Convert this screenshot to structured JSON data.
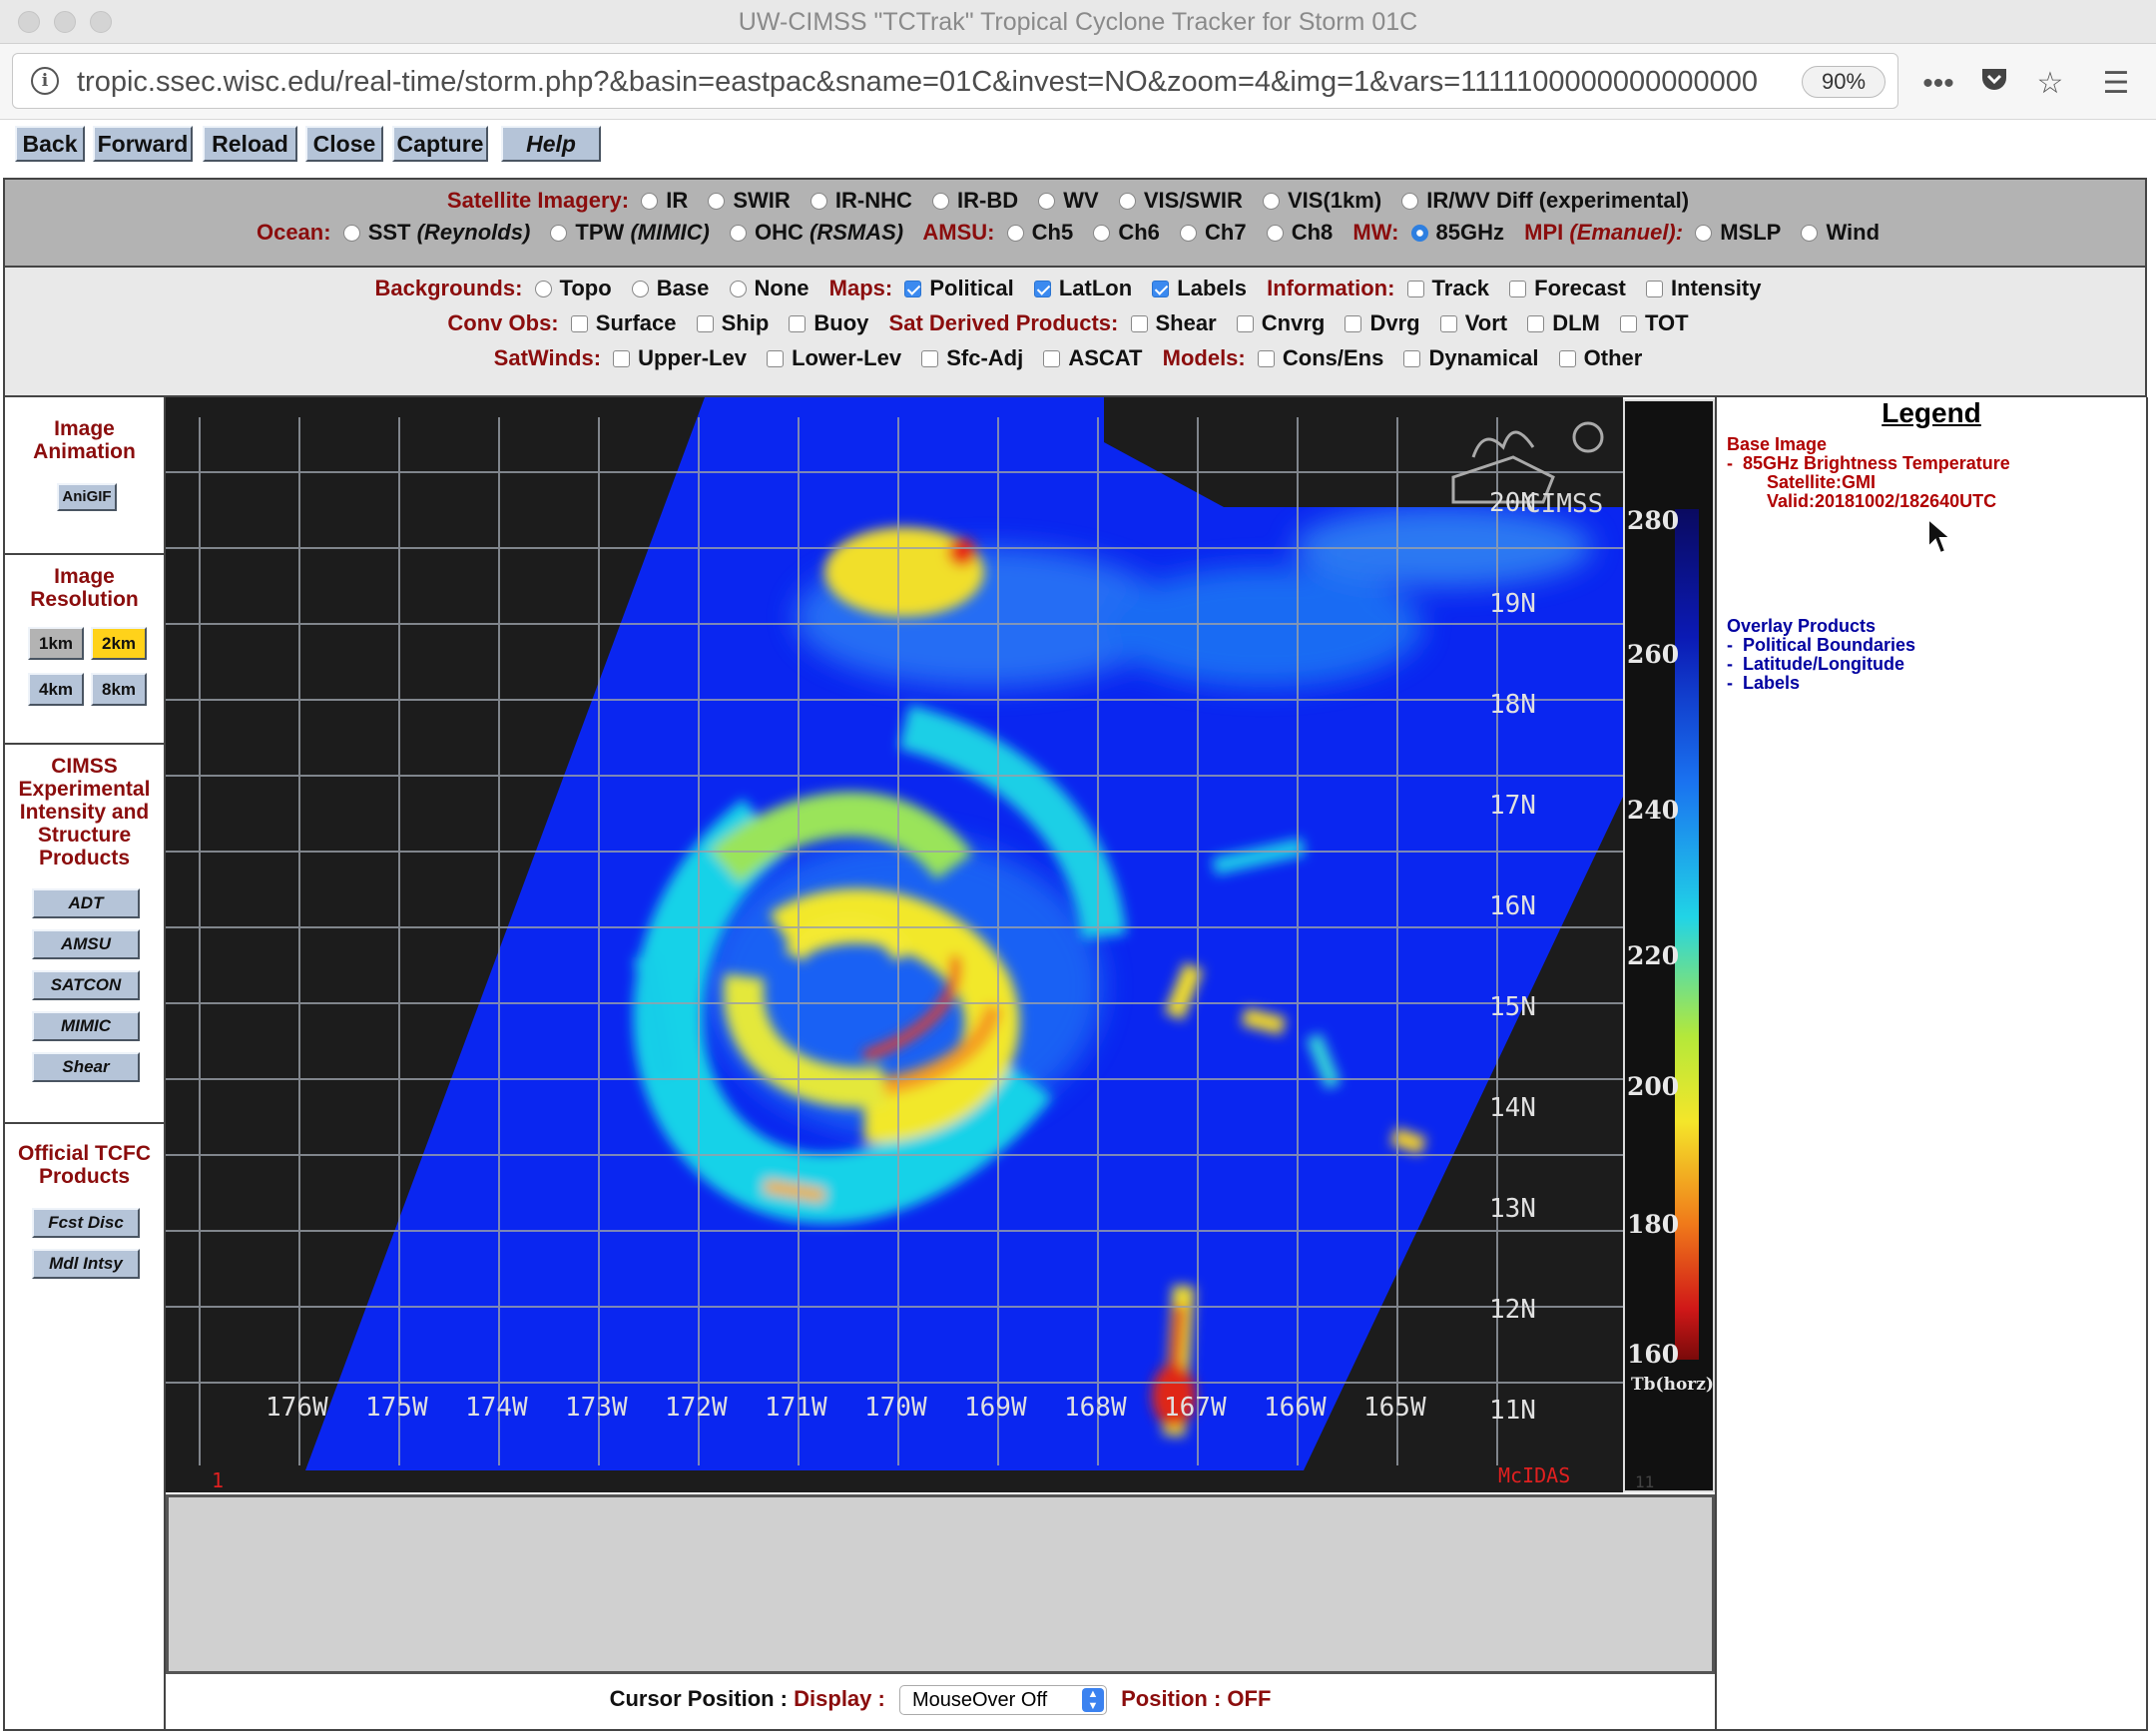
{
  "window": {
    "title": "UW-CIMSS \"TCTrak\" Tropical Cyclone Tracker for Storm 01C"
  },
  "browser": {
    "url": "tropic.ssec.wisc.edu/real-time/storm.php?&basin=eastpac&sname=01C&invest=NO&zoom=4&img=1&vars=1111100000000000000",
    "zoom": "90%",
    "icons": [
      "info-icon",
      "more-icon",
      "pocket-icon",
      "bookmark-star-icon",
      "reader-menu-icon"
    ]
  },
  "nav_buttons": {
    "back": "Back",
    "forward": "Forward",
    "reload": "Reload",
    "close": "Close",
    "capture": "Capture",
    "help": "Help"
  },
  "row1": {
    "label": "Satellite Imagery:",
    "options": [
      "IR",
      "SWIR",
      "IR-NHC",
      "IR-BD",
      "WV",
      "VIS/SWIR",
      "VIS(1km)",
      "IR/WV Diff (experimental)"
    ]
  },
  "row2": {
    "ocean_label": "Ocean:",
    "sst": "SST",
    "sst_src": "(Reynolds)",
    "tpw": "TPW",
    "tpw_src": "(MIMIC)",
    "ohc": "OHC",
    "ohc_src": "(RSMAS)",
    "amsu_label": "AMSU:",
    "amsu": [
      "Ch5",
      "Ch6",
      "Ch7",
      "Ch8"
    ],
    "mw_label": "MW:",
    "mw": "85GHz",
    "mpi_label": "MPI",
    "mpi_src": "(Emanuel):",
    "mpi": [
      "MSLP",
      "Wind"
    ]
  },
  "row3": {
    "bg_label": "Backgrounds:",
    "bg": [
      "Topo",
      "Base",
      "None"
    ],
    "maps_label": "Maps:",
    "maps": [
      "Political",
      "LatLon",
      "Labels"
    ],
    "info_label": "Information:",
    "info": [
      "Track",
      "Forecast",
      "Intensity"
    ]
  },
  "row4": {
    "conv_label": "Conv Obs:",
    "conv": [
      "Surface",
      "Ship",
      "Buoy"
    ],
    "sat_label": "Sat Derived Products:",
    "sat": [
      "Shear",
      "Cnvrg",
      "Dvrg",
      "Vort",
      "DLM",
      "TOT"
    ]
  },
  "row5": {
    "winds_label": "SatWinds:",
    "winds": [
      "Upper-Lev",
      "Lower-Lev",
      "Sfc-Adj",
      "ASCAT"
    ],
    "models_label": "Models:",
    "models": [
      "Cons/Ens",
      "Dynamical",
      "Other"
    ]
  },
  "left": {
    "anim_title": "Image Animation",
    "anigif": "AniGIF",
    "res_title": "Image Resolution",
    "res": [
      "1km",
      "2km",
      "4km",
      "8km"
    ],
    "cimss_title": "CIMSS Experimental Intensity and Structure Products",
    "cimss": [
      "ADT",
      "AMSU",
      "SATCON",
      "MIMIC",
      "Shear"
    ],
    "tcfc_title": "Official TCFC Products",
    "tcfc": [
      "Fcst Disc",
      "Mdl Intsy"
    ]
  },
  "image": {
    "lat_labels": [
      "20N",
      "19N",
      "18N",
      "17N",
      "16N",
      "15N",
      "14N",
      "13N",
      "12N",
      "11N"
    ],
    "lon_labels": [
      "176W",
      "175W",
      "174W",
      "173W",
      "172W",
      "171W",
      "170W",
      "169W",
      "168W",
      "167W",
      "166W",
      "165W"
    ],
    "frame": "1",
    "mcidas": "McIDAS",
    "logo_text": "CIMSS"
  },
  "colorbar": {
    "ticks": [
      "280",
      "260",
      "240",
      "220",
      "200",
      "180",
      "160"
    ],
    "unit": "Tb(horz)",
    "frame": "11"
  },
  "legend": {
    "title": "Legend",
    "base_title": "Base Image",
    "base_item": "85GHz Brightness Temperature",
    "satellite": "Satellite:GMI",
    "valid": "Valid:20181002/182640UTC",
    "overlay_title": "Overlay Products",
    "overlays": [
      "Political Boundaries",
      "Latitude/Longitude",
      "Labels"
    ]
  },
  "cursor": {
    "label": "Cursor Position :",
    "display_label": "Display :",
    "display_value": "MouseOver Off",
    "position_label": "Position : OFF"
  },
  "colors": {
    "category": "#8b0d0d",
    "legend_base": "#b00000",
    "legend_overlay": "#0000a0",
    "button": "#b5c4d8",
    "selected": "#ffd21a"
  }
}
